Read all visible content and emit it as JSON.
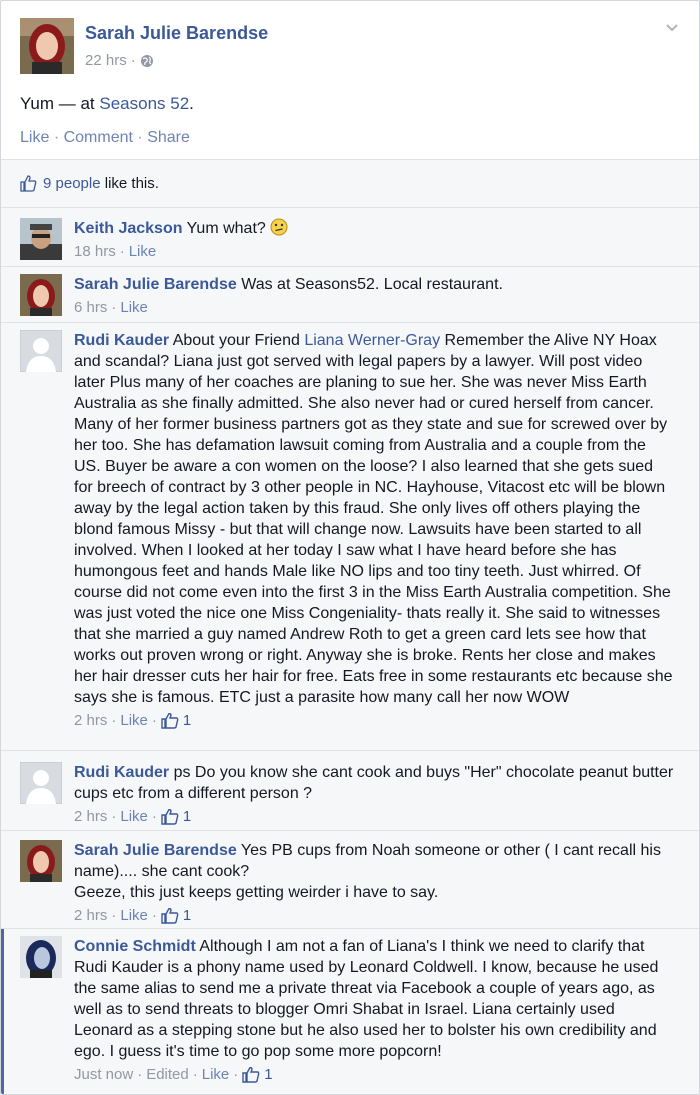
{
  "post": {
    "author": "Sarah Julie Barendse",
    "time": "22 hrs",
    "sep": "·",
    "text_prefix": "Yum — at ",
    "location": "Seasons 52",
    "text_suffix": ".",
    "actions": {
      "like": "Like",
      "comment": "Comment",
      "share": "Share"
    },
    "privacy_icon": "globe-icon"
  },
  "likes": {
    "count_text": "9 people",
    "suffix": " like this."
  },
  "comments": [
    {
      "author": "Keith Jackson",
      "text": " Yum what? ",
      "time": "18 hrs",
      "like_label": "Like",
      "avatar": "keith-avatar",
      "emoticon": "confused-emoticon"
    },
    {
      "author": "Sarah Julie Barendse",
      "text": " Was at Seasons52. Local restaurant.",
      "time": "6 hrs",
      "like_label": "Like",
      "avatar": "sarah-avatar"
    },
    {
      "author": "Rudi Kauder",
      "text_pre": " About your Friend ",
      "link": "Liana Werner-Gray",
      "text_post": " Remember the Alive NY Hoax and scandal? Liana just got served with legal papers by a lawyer. Will post video later Plus many of her coaches are planing to sue her. She was never Miss Earth Australia as she finally admitted. She also never had or cured herself from cancer. Many of her former business partners got as they state and sue for screwed over by her too. She has defamation lawsuit coming from Australia and a couple from the US. Buyer be aware a con women on the loose? I also learned that she gets sued for breech of contract by 3 other people in NC. Hayhouse, Vitacost etc will be blown away by the legal action taken by this fraud. She only lives off others playing the blond famous Missy - but that will change now. Lawsuits have been started to all involved. When I looked at her today I saw what I have heard before she has humongous feet and hands Male like NO lips and too tiny teeth. Just whirred. Of course did not come even into the first 3 in the Miss Earth Australia competition. She was just voted the nice one Miss Congeniality- thats really it. She said to witnesses that she married a guy named Andrew Roth to get a green card lets see how that works out proven wrong or right. Anyway she is broke. Rents her close and makes her hair dresser cuts her hair for free. Eats free in some restaurants etc because she says she is famous. ETC just a parasite how many call her now WOW",
      "time": "2 hrs",
      "like_label": "Like",
      "likes": "1",
      "avatar": "default-avatar"
    },
    {
      "author": "Rudi Kauder",
      "text": " ps Do you know she cant cook and buys \"Her\" chocolate peanut butter cups etc from a different person ?",
      "time": "2 hrs",
      "like_label": "Like",
      "likes": "1",
      "avatar": "default-avatar"
    },
    {
      "author": "Sarah Julie Barendse",
      "text": " Yes PB cups from Noah someone or other ( I cant recall his name).... she cant cook?",
      "text2": "Geeze, this just keeps getting weirder i have to say.",
      "time": "2 hrs",
      "like_label": "Like",
      "likes": "1",
      "avatar": "sarah-avatar"
    },
    {
      "author": "Connie Schmidt",
      "text": " Although I am not a fan of Liana's I think we need to clarify that Rudi Kauder is a phony name used by Leonard Coldwell. I know, because he used the same alias to send me a private threat via Facebook a couple of years ago, as well as to send threats to blogger Omri Shabat in Israel. Liana certainly used Leonard as a stepping stone but he also used her to bolster his own credibility and ego. I guess it's time to go pop some more popcorn!",
      "time": "Just now",
      "edited": "Edited",
      "like_label": "Like",
      "likes": "1",
      "avatar": "connie-avatar"
    }
  ],
  "colors": {
    "link": "#3b5998",
    "meta": "#9197a3",
    "action": "#6d84b4",
    "background": "#f6f7f9"
  }
}
